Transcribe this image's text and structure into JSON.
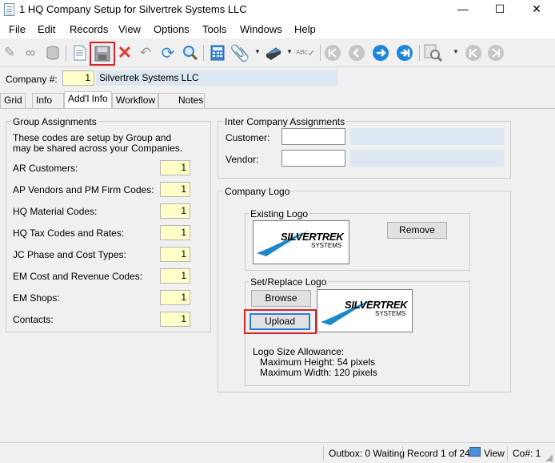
{
  "window": {
    "title": "1 HQ Company Setup for Silvertrek Systems LLC",
    "controls": {
      "minimize": "—",
      "maximize": "☐",
      "close": "✕"
    }
  },
  "menu": [
    "File",
    "Edit",
    "Records",
    "View",
    "Options",
    "Tools",
    "Windows",
    "Help"
  ],
  "toolbar": {
    "icons": [
      "new-record-icon",
      "binoculars-icon",
      "database-icon",
      "page-icon",
      "save-icon",
      "delete-icon",
      "undo-icon",
      "refresh-icon",
      "search-icon",
      "calculator-icon",
      "attachment-icon",
      "scanner-icon",
      "spellcheck-icon",
      "first-record-icon",
      "previous-record-icon",
      "next-record-icon",
      "last-record-icon",
      "filter-icon",
      "prev-icon",
      "next-icon"
    ],
    "highlighted": "save-icon"
  },
  "company": {
    "label": "Company #:",
    "number": "1",
    "name": "Silvertrek Systems LLC"
  },
  "tabs": [
    "Grid",
    "Info",
    "Add'l Info",
    "Workflow",
    "Notes"
  ],
  "active_tab": "Add'l Info",
  "group_assignments": {
    "title": "Group Assignments",
    "description": "These codes are setup by Group and may be shared across your Companies.",
    "rows": [
      {
        "label": "AR Customers:",
        "value": "1"
      },
      {
        "label": "AP Vendors and PM Firm Codes:",
        "value": "1"
      },
      {
        "label": "HQ Material Codes:",
        "value": "1"
      },
      {
        "label": "HQ Tax Codes and Rates:",
        "value": "1"
      },
      {
        "label": "JC Phase and Cost Types:",
        "value": "1"
      },
      {
        "label": "EM Cost and Revenue Codes:",
        "value": "1"
      },
      {
        "label": "EM Shops:",
        "value": "1"
      },
      {
        "label": "Contacts:",
        "value": "1"
      }
    ]
  },
  "inter_company": {
    "title": "Inter Company Assignments",
    "customer_label": "Customer:",
    "customer_value": "",
    "vendor_label": "Vendor:",
    "vendor_value": ""
  },
  "company_logo": {
    "title": "Company Logo",
    "existing_title": "Existing Logo",
    "remove_label": "Remove",
    "replace_title": "Set/Replace Logo",
    "browse_label": "Browse",
    "upload_label": "Upload",
    "logo_text_main": "SILVERTREK",
    "logo_text_sub": "SYSTEMS",
    "allowance_title": "Logo Size Allowance:",
    "max_height": "Maximum Height: 54 pixels",
    "max_width": "Maximum Width: 120 pixels"
  },
  "status": {
    "outbox": "Outbox: 0 Waiting",
    "record": "Record 1 of 24",
    "view": "View",
    "co": "Co#: 1"
  },
  "colors": {
    "accent_red": "#d9232a",
    "focus_blue": "#2c7bd8",
    "logo_blue": "#1e88c8",
    "required_yellow": "#ffffc8"
  }
}
